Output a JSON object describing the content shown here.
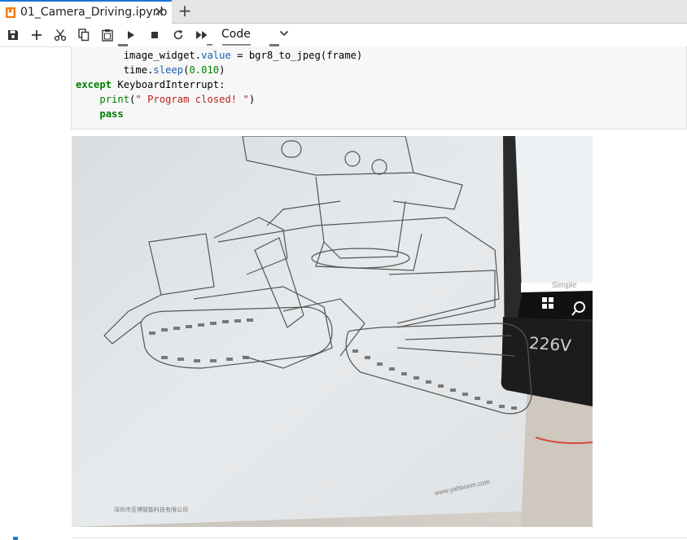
{
  "tab": {
    "title": "01_Camera_Driving.ipynb",
    "close": "✕"
  },
  "newtab": "+",
  "toolbar": {
    "cell_type": "Code",
    "icons": [
      "save-icon",
      "add-cell-icon",
      "cut-icon",
      "copy-icon",
      "paste-icon",
      "run-icon",
      "stop-icon",
      "restart-icon",
      "run-all-icon",
      "chevron-down-icon"
    ]
  },
  "code": {
    "line1_var": "image_widget",
    "line1_attr": "value",
    "line1_eq": " = ",
    "line1_call": "bgr8_to_jpeg(frame)",
    "line2_mod": "time",
    "line2_fn": "sleep",
    "line2_arg": "0.010",
    "line3_kw": "except",
    "line3_exc": "KeyboardInterrupt:",
    "line4_fn": "print",
    "line4_str": "\" Program closed! \"",
    "line5_kw": "pass"
  },
  "output": {
    "camera_text_box": "226V",
    "camera_text_simple": "Simple",
    "camera_text_url": "www.yahboom.com",
    "camera_text_company": "深圳市亚博智能科技有限公司"
  },
  "colors": {
    "accent": "#1976d2",
    "keyword": "#008000",
    "string": "#ba2121",
    "attr": "#1a5fb4"
  }
}
